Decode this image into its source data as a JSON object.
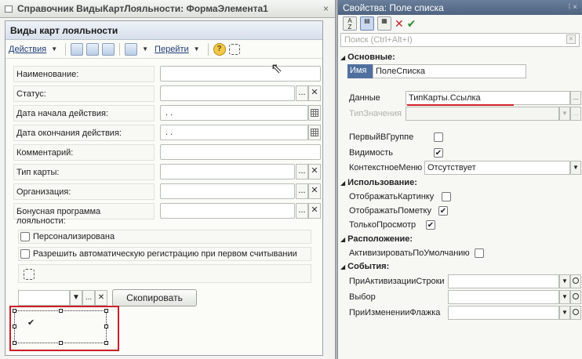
{
  "designer": {
    "title": "Справочник ВидыКартЛояльности: ФормаЭлемента1",
    "form_header": "Виды карт лояльности",
    "toolbar": {
      "actions": "Действия",
      "goto": "Перейти",
      "help": "?"
    },
    "fields": [
      {
        "label": "Наименование:",
        "value": "",
        "buttons": "none"
      },
      {
        "label": "Статус:",
        "value": "",
        "buttons": "choose-clear"
      },
      {
        "label": "Дата начала действия:",
        "value": " .  .",
        "buttons": "calendar"
      },
      {
        "label": "Дата окончания действия:",
        "value": " .  .",
        "buttons": "calendar"
      },
      {
        "label": "Комментарий:",
        "value": "",
        "buttons": "none"
      },
      {
        "label": "Тип карты:",
        "value": "",
        "buttons": "choose-clear"
      },
      {
        "label": "Организация:",
        "value": "",
        "buttons": "choose-clear"
      },
      {
        "label": "Бонусная программа лояльности:",
        "value": "",
        "buttons": "choose-clear"
      }
    ],
    "checkboxes": [
      {
        "label": "Персонализирована",
        "checked": false
      },
      {
        "label": "Разрешить автоматическую регистрацию при первом считывании",
        "checked": false
      }
    ],
    "copy_button": "Скопировать",
    "selected_list_check": "✔"
  },
  "props": {
    "title": "Свойства: Поле списка",
    "pin": "⁞ ×",
    "search_placeholder": "Поиск (Ctrl+Alt+I)",
    "sections": {
      "main": "Основные:",
      "usage": "Использование:",
      "layout": "Расположение:",
      "events": "События:"
    },
    "name_tag": "Имя",
    "name_value": "ПолеСписка",
    "data_label": "Данные",
    "data_value": "ТипКарты.Ссылка",
    "value_type_label": "ТипЗначения",
    "first_in_group_label": "ПервыйВГруппе",
    "first_in_group_checked": false,
    "visibility_label": "Видимость",
    "visibility_checked": true,
    "context_menu_label": "КонтекстноеМеню",
    "context_menu_value": "Отсутствует",
    "show_picture_label": "ОтображатьКартинку",
    "show_picture_checked": false,
    "show_mark_label": "ОтображатьПометку",
    "show_mark_checked": true,
    "readonly_label": "ТолькоПросмотр",
    "readonly_checked": true,
    "activate_default_label": "АктивизироватьПоУмолчанию",
    "activate_default_checked": false,
    "events": [
      "ПриАктивизацииСтроки",
      "Выбор",
      "ПриИзмененииФлажка"
    ]
  }
}
